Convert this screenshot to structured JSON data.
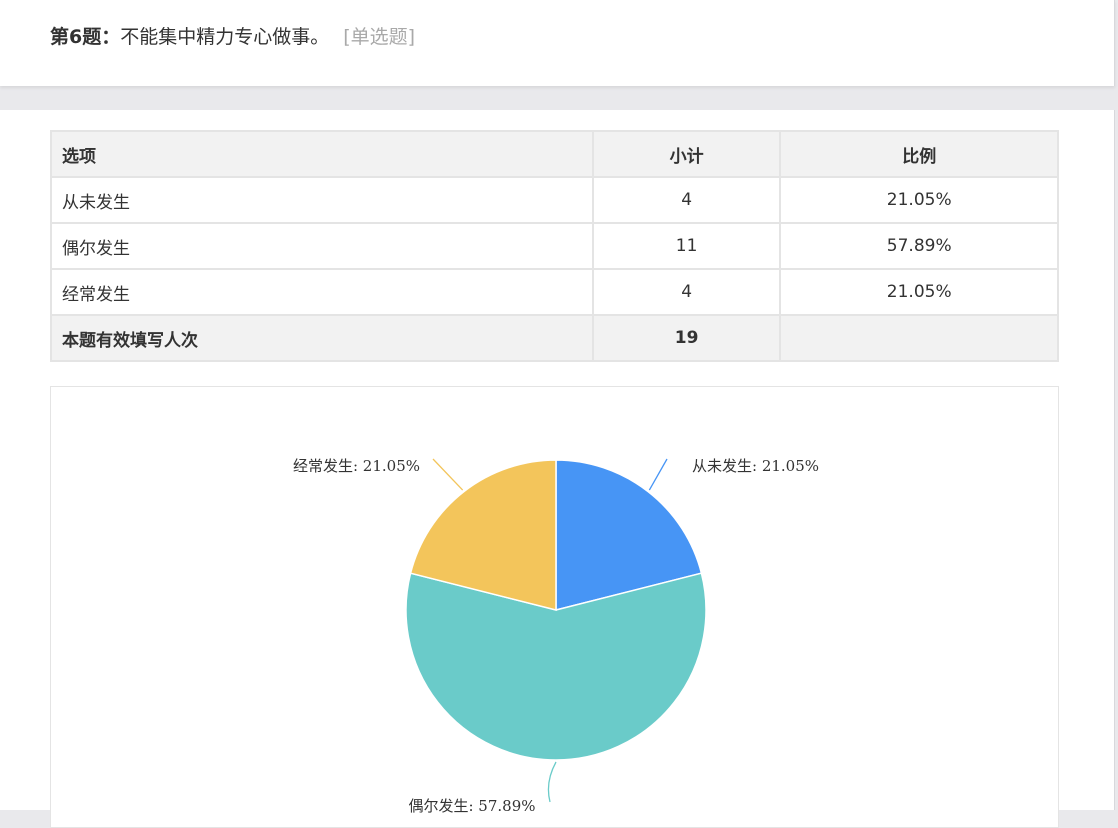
{
  "question": {
    "number_label": "第6题",
    "colon": "：",
    "text": "不能集中精力专心做事。",
    "type_label": "[单选题]"
  },
  "table": {
    "headers": [
      "选项",
      "小计",
      "比例"
    ],
    "rows": [
      {
        "option": "从未发生",
        "count": "4",
        "percent": "21.05%"
      },
      {
        "option": "偶尔发生",
        "count": "11",
        "percent": "57.89%"
      },
      {
        "option": "经常发生",
        "count": "4",
        "percent": "21.05%"
      }
    ],
    "total": {
      "label": "本题有效填写人次",
      "count": "19",
      "percent": ""
    }
  },
  "chart_data": {
    "type": "pie",
    "categories": [
      "从未发生",
      "偶尔发生",
      "经常发生"
    ],
    "values": [
      21.05,
      57.89,
      21.05
    ],
    "labels": [
      "从未发生: 21.05%",
      "偶尔发生: 57.89%",
      "经常发生: 21.05%"
    ],
    "colors": [
      "#4795f5",
      "#6acbc9",
      "#f3c55b"
    ],
    "title": ""
  }
}
